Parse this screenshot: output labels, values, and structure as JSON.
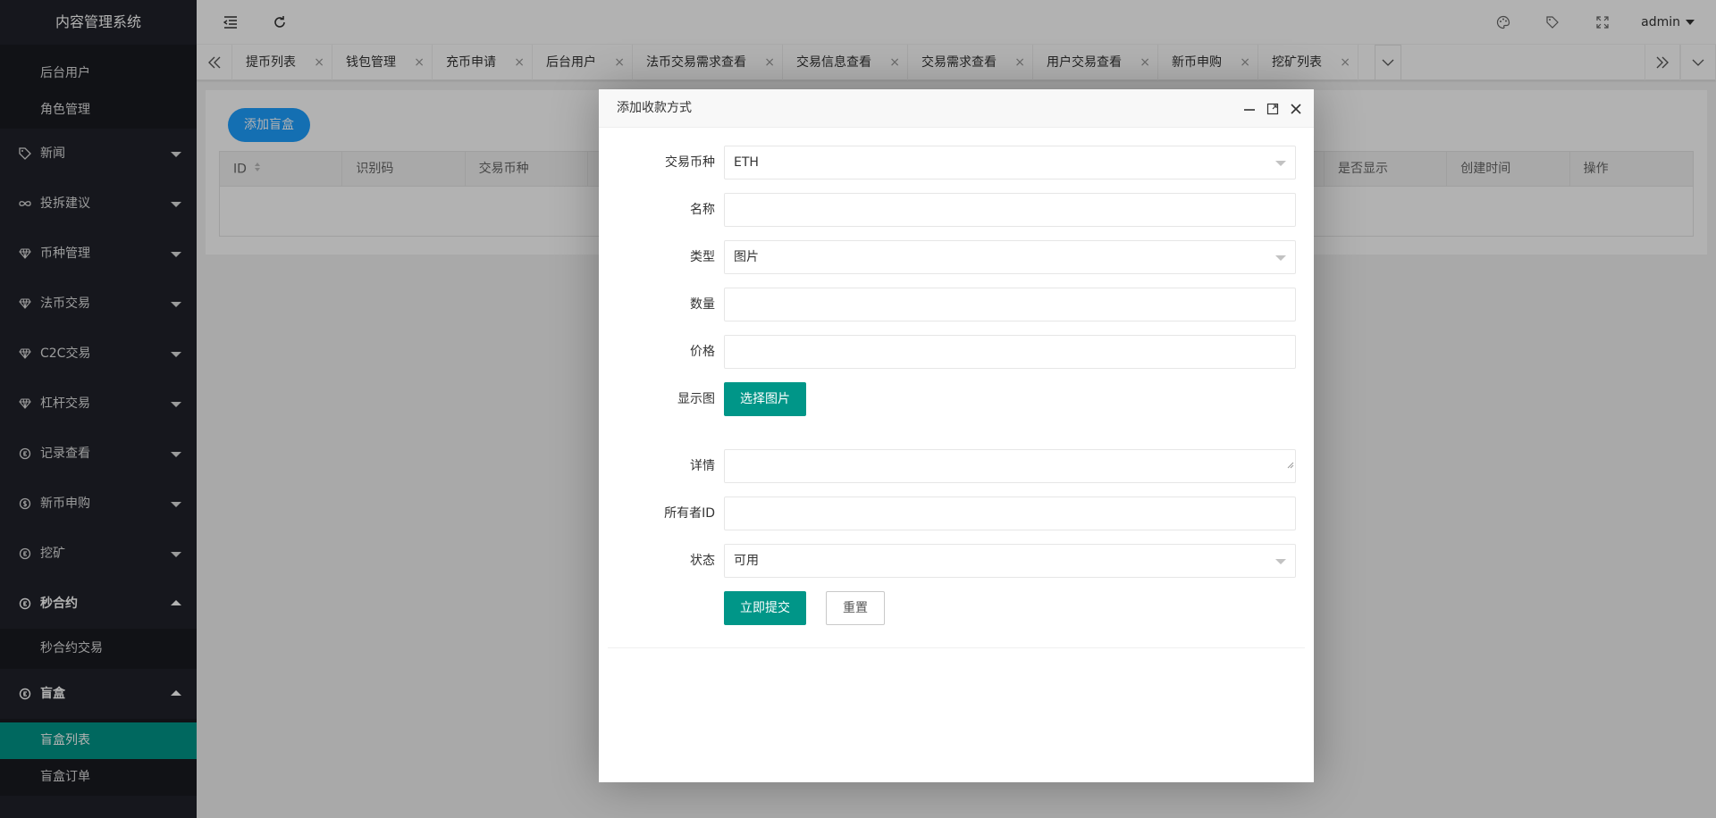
{
  "app": {
    "title": "内容管理系统"
  },
  "colors": {
    "accent": "#009688",
    "primary": "#1e9fff",
    "sidebar_bg": "#20222a"
  },
  "sidebar": {
    "top_sub_items": [
      "后台用户",
      "角色管理"
    ],
    "menu": [
      {
        "label": "新闻",
        "icon": "tag-icon"
      },
      {
        "label": "投拆建议",
        "icon": "infinity-icon"
      },
      {
        "label": "币种管理",
        "icon": "diamond-icon"
      },
      {
        "label": "法币交易",
        "icon": "diamond-icon"
      },
      {
        "label": "C2C交易",
        "icon": "diamond-icon"
      },
      {
        "label": "杠杆交易",
        "icon": "diamond-icon"
      },
      {
        "label": "记录查看",
        "icon": "rmb-circle-icon"
      },
      {
        "label": "新币申购",
        "icon": "dollar-circle-icon"
      },
      {
        "label": "挖矿",
        "icon": "rmb-circle-icon"
      }
    ],
    "contract": {
      "label": "秒合约",
      "icon": "rmb-circle-icon",
      "sub_items": [
        "秒合约交易"
      ]
    },
    "blindbox": {
      "label": "盲盒",
      "icon": "rmb-circle-icon",
      "sub_items": [
        "盲盒列表",
        "盲盒订单"
      ],
      "active": "盲盒列表"
    }
  },
  "header": {
    "user": "admin"
  },
  "tabs": [
    "提币列表",
    "钱包管理",
    "充币申请",
    "后台用户",
    "法币交易需求查看",
    "交易信息查看",
    "交易需求查看",
    "用户交易查看",
    "新币申购",
    "挖矿列表"
  ],
  "tab_close": "×",
  "page": {
    "add_button": "添加盲盒",
    "columns": [
      "ID",
      "识别码",
      "交易币种",
      "",
      "",
      "",
      "",
      "",
      "",
      "是否显示",
      "创建时间",
      "操作"
    ]
  },
  "modal": {
    "title": "添加收款方式",
    "fields": {
      "currency": {
        "label": "交易币种",
        "value": "ETH"
      },
      "name": {
        "label": "名称",
        "value": ""
      },
      "type": {
        "label": "类型",
        "value": "图片"
      },
      "quantity": {
        "label": "数量",
        "value": ""
      },
      "price": {
        "label": "价格",
        "value": ""
      },
      "image": {
        "label": "显示图",
        "button": "选择图片"
      },
      "detail": {
        "label": "详情",
        "value": ""
      },
      "owner": {
        "label": "所有者ID",
        "value": ""
      },
      "status": {
        "label": "状态",
        "value": "可用"
      }
    },
    "submit": "立即提交",
    "reset": "重置"
  }
}
